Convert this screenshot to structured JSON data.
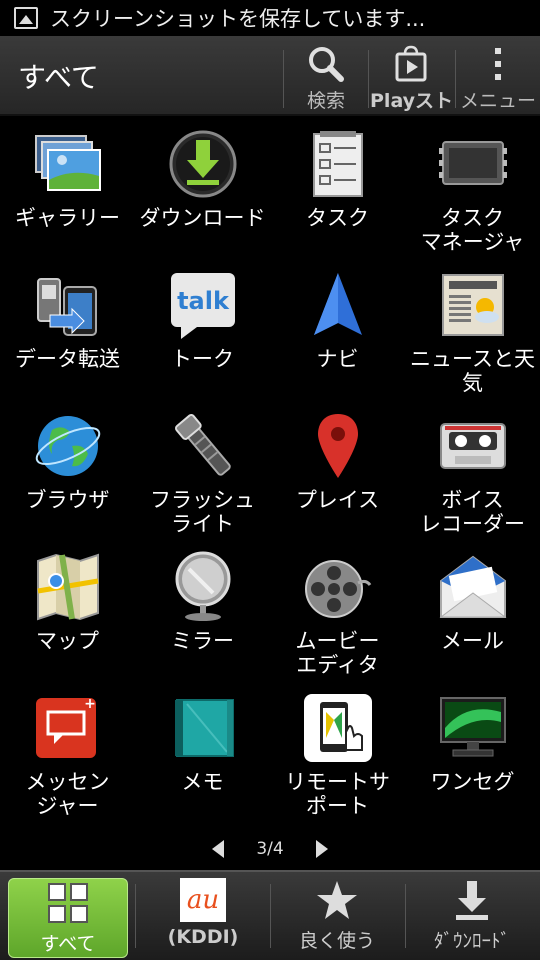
{
  "status_bar": {
    "text": "スクリーンショットを保存しています..."
  },
  "action_bar": {
    "title": "すべて",
    "search_label": "検索",
    "play_label": "Playスト",
    "menu_label": "メニュー"
  },
  "apps": [
    {
      "label": "ギャラリー",
      "icon": "gallery-icon"
    },
    {
      "label": "ダウンロード",
      "icon": "download-icon"
    },
    {
      "label": "タスク",
      "icon": "task-icon"
    },
    {
      "label": "タスク\nマネージャ",
      "icon": "task-manager-icon"
    },
    {
      "label": "データ転送",
      "icon": "data-transfer-icon"
    },
    {
      "label": "トーク",
      "icon": "talk-icon"
    },
    {
      "label": "ナビ",
      "icon": "navigation-icon"
    },
    {
      "label": "ニュースと天\n気",
      "icon": "news-weather-icon"
    },
    {
      "label": "ブラウザ",
      "icon": "browser-globe-icon"
    },
    {
      "label": "フラッシュ\nライト",
      "icon": "flashlight-icon"
    },
    {
      "label": "プレイス",
      "icon": "places-pin-icon"
    },
    {
      "label": "ボイス\nレコーダー",
      "icon": "cassette-recorder-icon"
    },
    {
      "label": "マップ",
      "icon": "maps-icon"
    },
    {
      "label": "ミラー",
      "icon": "mirror-icon"
    },
    {
      "label": "ムービー\nエディタ",
      "icon": "film-reel-icon"
    },
    {
      "label": "メール",
      "icon": "mail-envelope-icon"
    },
    {
      "label": "メッセン\nジャー",
      "icon": "messenger-icon"
    },
    {
      "label": "メモ",
      "icon": "notebook-icon"
    },
    {
      "label": "リモートサ\nポート",
      "icon": "remote-support-icon"
    },
    {
      "label": "ワンセグ",
      "icon": "tv-icon"
    }
  ],
  "pager": {
    "text": "3/4"
  },
  "bottom_bar": {
    "all_label": "すべて",
    "kddi_label": "(KDDI)",
    "kddi_logo": "au",
    "favorites_label": "良く使う",
    "download_label": "ﾀﾞｳﾝﾛｰﾄﾞ"
  },
  "colors": {
    "active_tab": "#7cc23c",
    "au_logo": "#e8501e",
    "background": "#000000"
  }
}
